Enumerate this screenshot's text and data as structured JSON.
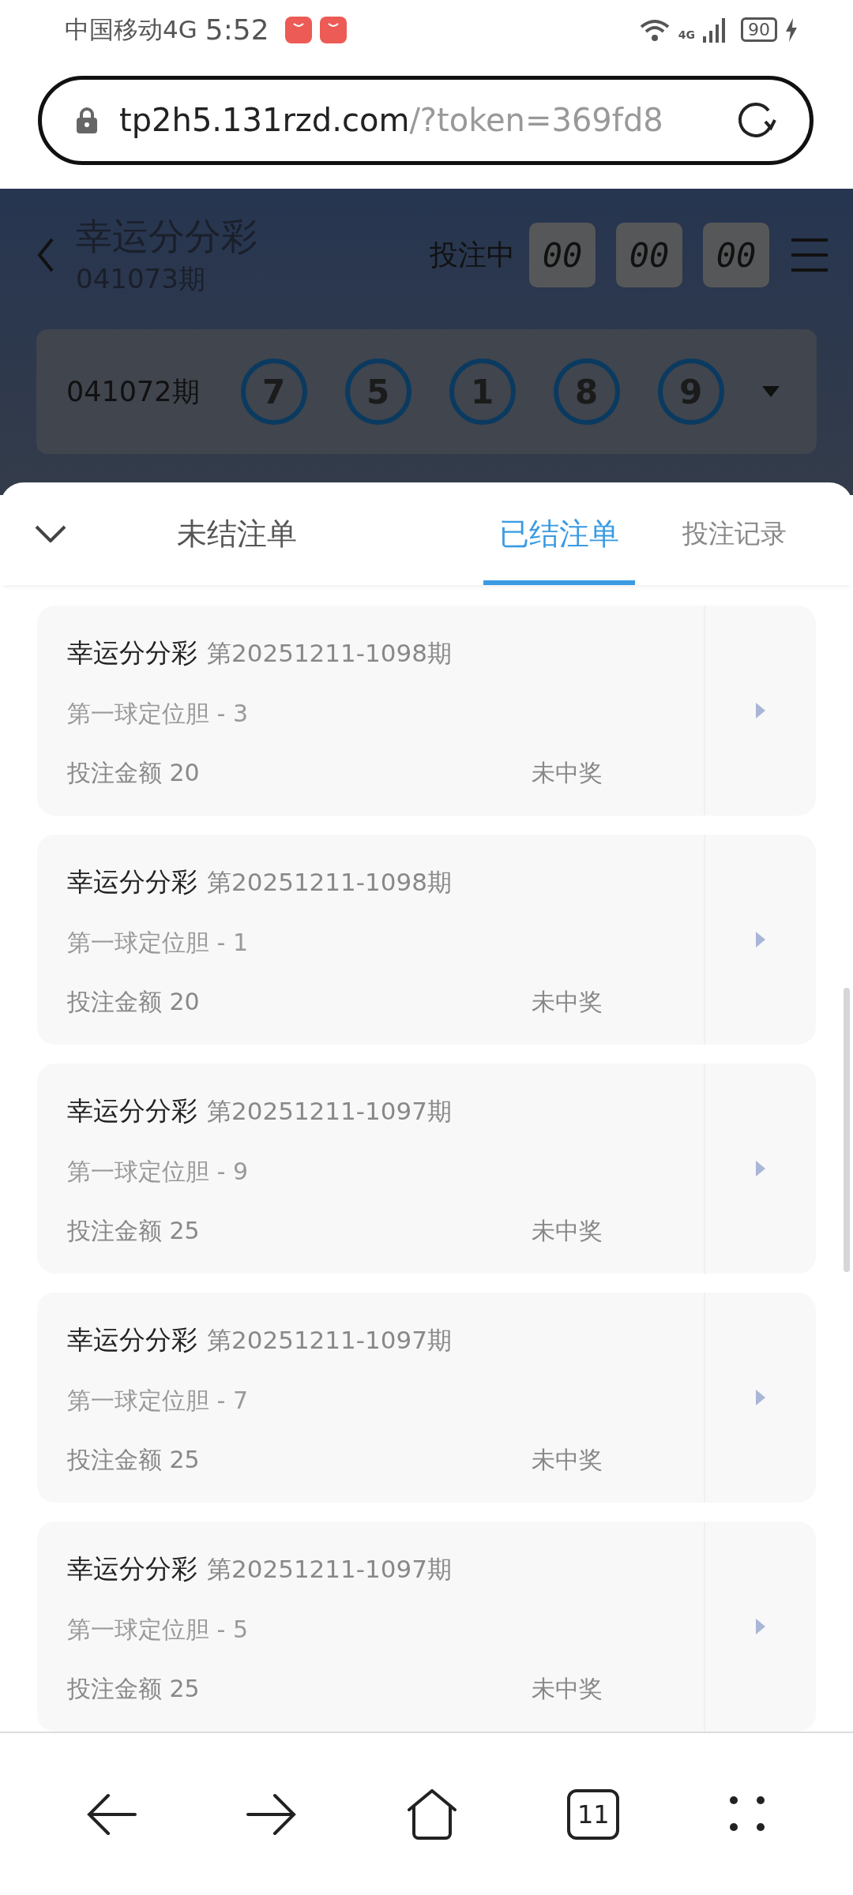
{
  "status_bar": {
    "carrier": "中国移动4G",
    "time": "5:52",
    "network": "4G",
    "battery": "90"
  },
  "address_bar": {
    "host": "tp2h5.131rzd.com",
    "path": "/?token=369fd8"
  },
  "header": {
    "title": "幸运分分彩",
    "period": "041073期",
    "timer_label": "投注中",
    "timer": [
      "00",
      "00",
      "00"
    ]
  },
  "last_draw": {
    "period": "041072期",
    "balls": [
      "7",
      "5",
      "1",
      "8",
      "9"
    ]
  },
  "tabs": [
    {
      "label": "未结注单",
      "selected": false
    },
    {
      "label": "已结注单",
      "selected": true
    },
    {
      "label": "投注记录",
      "selected": false
    }
  ],
  "orders": [
    {
      "game": "幸运分分彩",
      "period": "第20251211-1098期",
      "bet": "第一球定位胆 - 3",
      "amount": "投注金额 20",
      "result": "未中奖"
    },
    {
      "game": "幸运分分彩",
      "period": "第20251211-1098期",
      "bet": "第一球定位胆 - 1",
      "amount": "投注金额 20",
      "result": "未中奖"
    },
    {
      "game": "幸运分分彩",
      "period": "第20251211-1097期",
      "bet": "第一球定位胆 - 9",
      "amount": "投注金额 25",
      "result": "未中奖"
    },
    {
      "game": "幸运分分彩",
      "period": "第20251211-1097期",
      "bet": "第一球定位胆 - 7",
      "amount": "投注金额 25",
      "result": "未中奖"
    },
    {
      "game": "幸运分分彩",
      "period": "第20251211-1097期",
      "bet": "第一球定位胆 - 5",
      "amount": "投注金额 25",
      "result": "未中奖"
    }
  ],
  "browser_nav": {
    "tab_count": "11"
  }
}
